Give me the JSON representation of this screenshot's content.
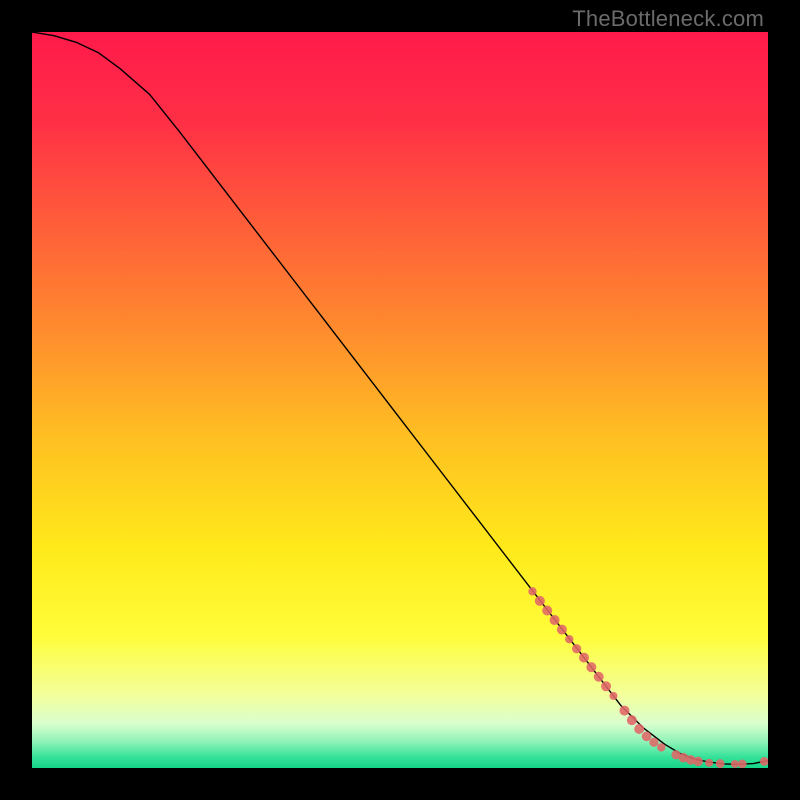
{
  "watermark": "TheBottleneck.com",
  "chart_data": {
    "type": "line",
    "title": "",
    "xlabel": "",
    "ylabel": "",
    "xlim": [
      0,
      100
    ],
    "ylim": [
      0,
      100
    ],
    "grid": false,
    "legend": false,
    "gradient_stops": [
      {
        "offset": 0.0,
        "color": "#ff1a4b"
      },
      {
        "offset": 0.12,
        "color": "#ff2f46"
      },
      {
        "offset": 0.25,
        "color": "#ff5a3a"
      },
      {
        "offset": 0.4,
        "color": "#ff8a2e"
      },
      {
        "offset": 0.55,
        "color": "#ffbf22"
      },
      {
        "offset": 0.7,
        "color": "#ffe91a"
      },
      {
        "offset": 0.82,
        "color": "#fffd3a"
      },
      {
        "offset": 0.9,
        "color": "#f3ff9a"
      },
      {
        "offset": 0.94,
        "color": "#d9ffcf"
      },
      {
        "offset": 0.965,
        "color": "#8cf2b6"
      },
      {
        "offset": 0.985,
        "color": "#36e29a"
      },
      {
        "offset": 1.0,
        "color": "#14d487"
      }
    ],
    "series": [
      {
        "name": "curve",
        "color": "#000000",
        "x": [
          0,
          3,
          6,
          9,
          12,
          16,
          20,
          25,
          30,
          35,
          40,
          45,
          50,
          55,
          60,
          65,
          70,
          75,
          80,
          83,
          86,
          88,
          90,
          92,
          94,
          96,
          98,
          100
        ],
        "y": [
          100,
          99.5,
          98.6,
          97.2,
          95.0,
          91.5,
          86.5,
          80.0,
          73.5,
          67.0,
          60.5,
          54.0,
          47.5,
          41.0,
          34.5,
          28.0,
          21.5,
          15.0,
          8.5,
          5.5,
          3.2,
          2.0,
          1.2,
          0.8,
          0.55,
          0.5,
          0.6,
          1.0
        ]
      },
      {
        "name": "markers",
        "type": "scatter",
        "color": "#e06666",
        "radius_base": 4.6,
        "points": [
          {
            "x": 68.0,
            "y": 24.0,
            "r": 4.2
          },
          {
            "x": 69.0,
            "y": 22.7,
            "r": 5.0
          },
          {
            "x": 70.0,
            "y": 21.4,
            "r": 5.0
          },
          {
            "x": 71.0,
            "y": 20.1,
            "r": 5.0
          },
          {
            "x": 72.0,
            "y": 18.8,
            "r": 5.0
          },
          {
            "x": 73.0,
            "y": 17.5,
            "r": 4.2
          },
          {
            "x": 74.0,
            "y": 16.2,
            "r": 4.6
          },
          {
            "x": 75.0,
            "y": 15.0,
            "r": 5.0
          },
          {
            "x": 76.0,
            "y": 13.7,
            "r": 5.0
          },
          {
            "x": 77.0,
            "y": 12.4,
            "r": 5.0
          },
          {
            "x": 78.0,
            "y": 11.1,
            "r": 5.0
          },
          {
            "x": 79.0,
            "y": 9.8,
            "r": 4.0
          },
          {
            "x": 80.5,
            "y": 7.8,
            "r": 5.0
          },
          {
            "x": 81.5,
            "y": 6.5,
            "r": 5.0
          },
          {
            "x": 82.5,
            "y": 5.3,
            "r": 5.0
          },
          {
            "x": 83.5,
            "y": 4.3,
            "r": 4.8
          },
          {
            "x": 84.5,
            "y": 3.5,
            "r": 4.6
          },
          {
            "x": 85.5,
            "y": 2.8,
            "r": 4.2
          },
          {
            "x": 87.5,
            "y": 1.8,
            "r": 4.6
          },
          {
            "x": 88.5,
            "y": 1.4,
            "r": 4.8
          },
          {
            "x": 89.5,
            "y": 1.1,
            "r": 4.8
          },
          {
            "x": 90.5,
            "y": 0.9,
            "r": 4.8
          },
          {
            "x": 92.0,
            "y": 0.7,
            "r": 4.0
          },
          {
            "x": 93.5,
            "y": 0.6,
            "r": 4.4
          },
          {
            "x": 95.5,
            "y": 0.55,
            "r": 4.0
          },
          {
            "x": 96.5,
            "y": 0.55,
            "r": 4.4
          },
          {
            "x": 99.5,
            "y": 0.9,
            "r": 4.4
          }
        ]
      }
    ]
  }
}
